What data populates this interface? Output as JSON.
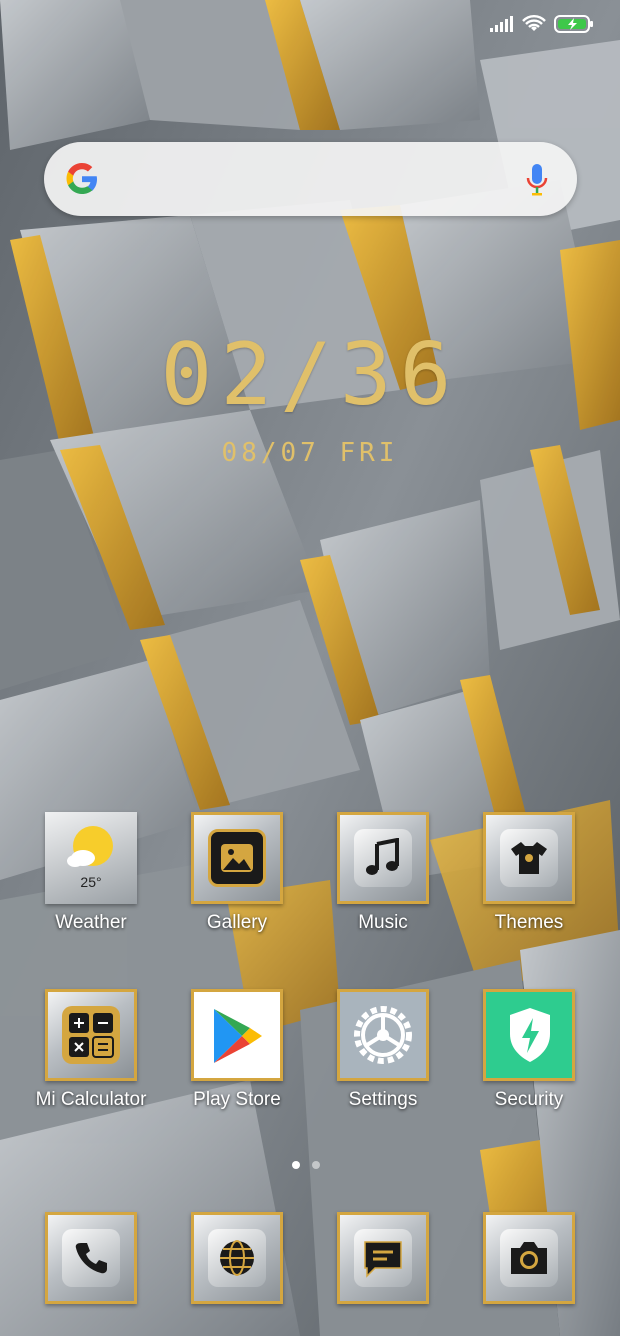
{
  "status_bar": {
    "icons": [
      "signal-icon",
      "wifi-icon",
      "battery-charging-icon"
    ]
  },
  "search": {
    "icons": [
      "google-logo-icon",
      "mic-icon"
    ]
  },
  "clock": {
    "time": "02/36",
    "date": "08/07 FRI"
  },
  "apps": [
    {
      "label": "Weather",
      "icon": "weather-icon",
      "extra": "25°"
    },
    {
      "label": "Gallery",
      "icon": "gallery-icon"
    },
    {
      "label": "Music",
      "icon": "music-icon"
    },
    {
      "label": "Themes",
      "icon": "themes-icon"
    },
    {
      "label": "Mi Calculator",
      "icon": "calculator-icon"
    },
    {
      "label": "Play Store",
      "icon": "play-store-icon"
    },
    {
      "label": "Settings",
      "icon": "settings-icon"
    },
    {
      "label": "Security",
      "icon": "security-icon"
    }
  ],
  "dock": [
    {
      "icon": "phone-icon"
    },
    {
      "icon": "browser-icon"
    },
    {
      "icon": "messages-icon"
    },
    {
      "icon": "camera-icon"
    }
  ],
  "page_indicator": {
    "pages": 2,
    "current": 1
  },
  "colors": {
    "accent": "#d4a640",
    "clock": "#e0c06a"
  }
}
